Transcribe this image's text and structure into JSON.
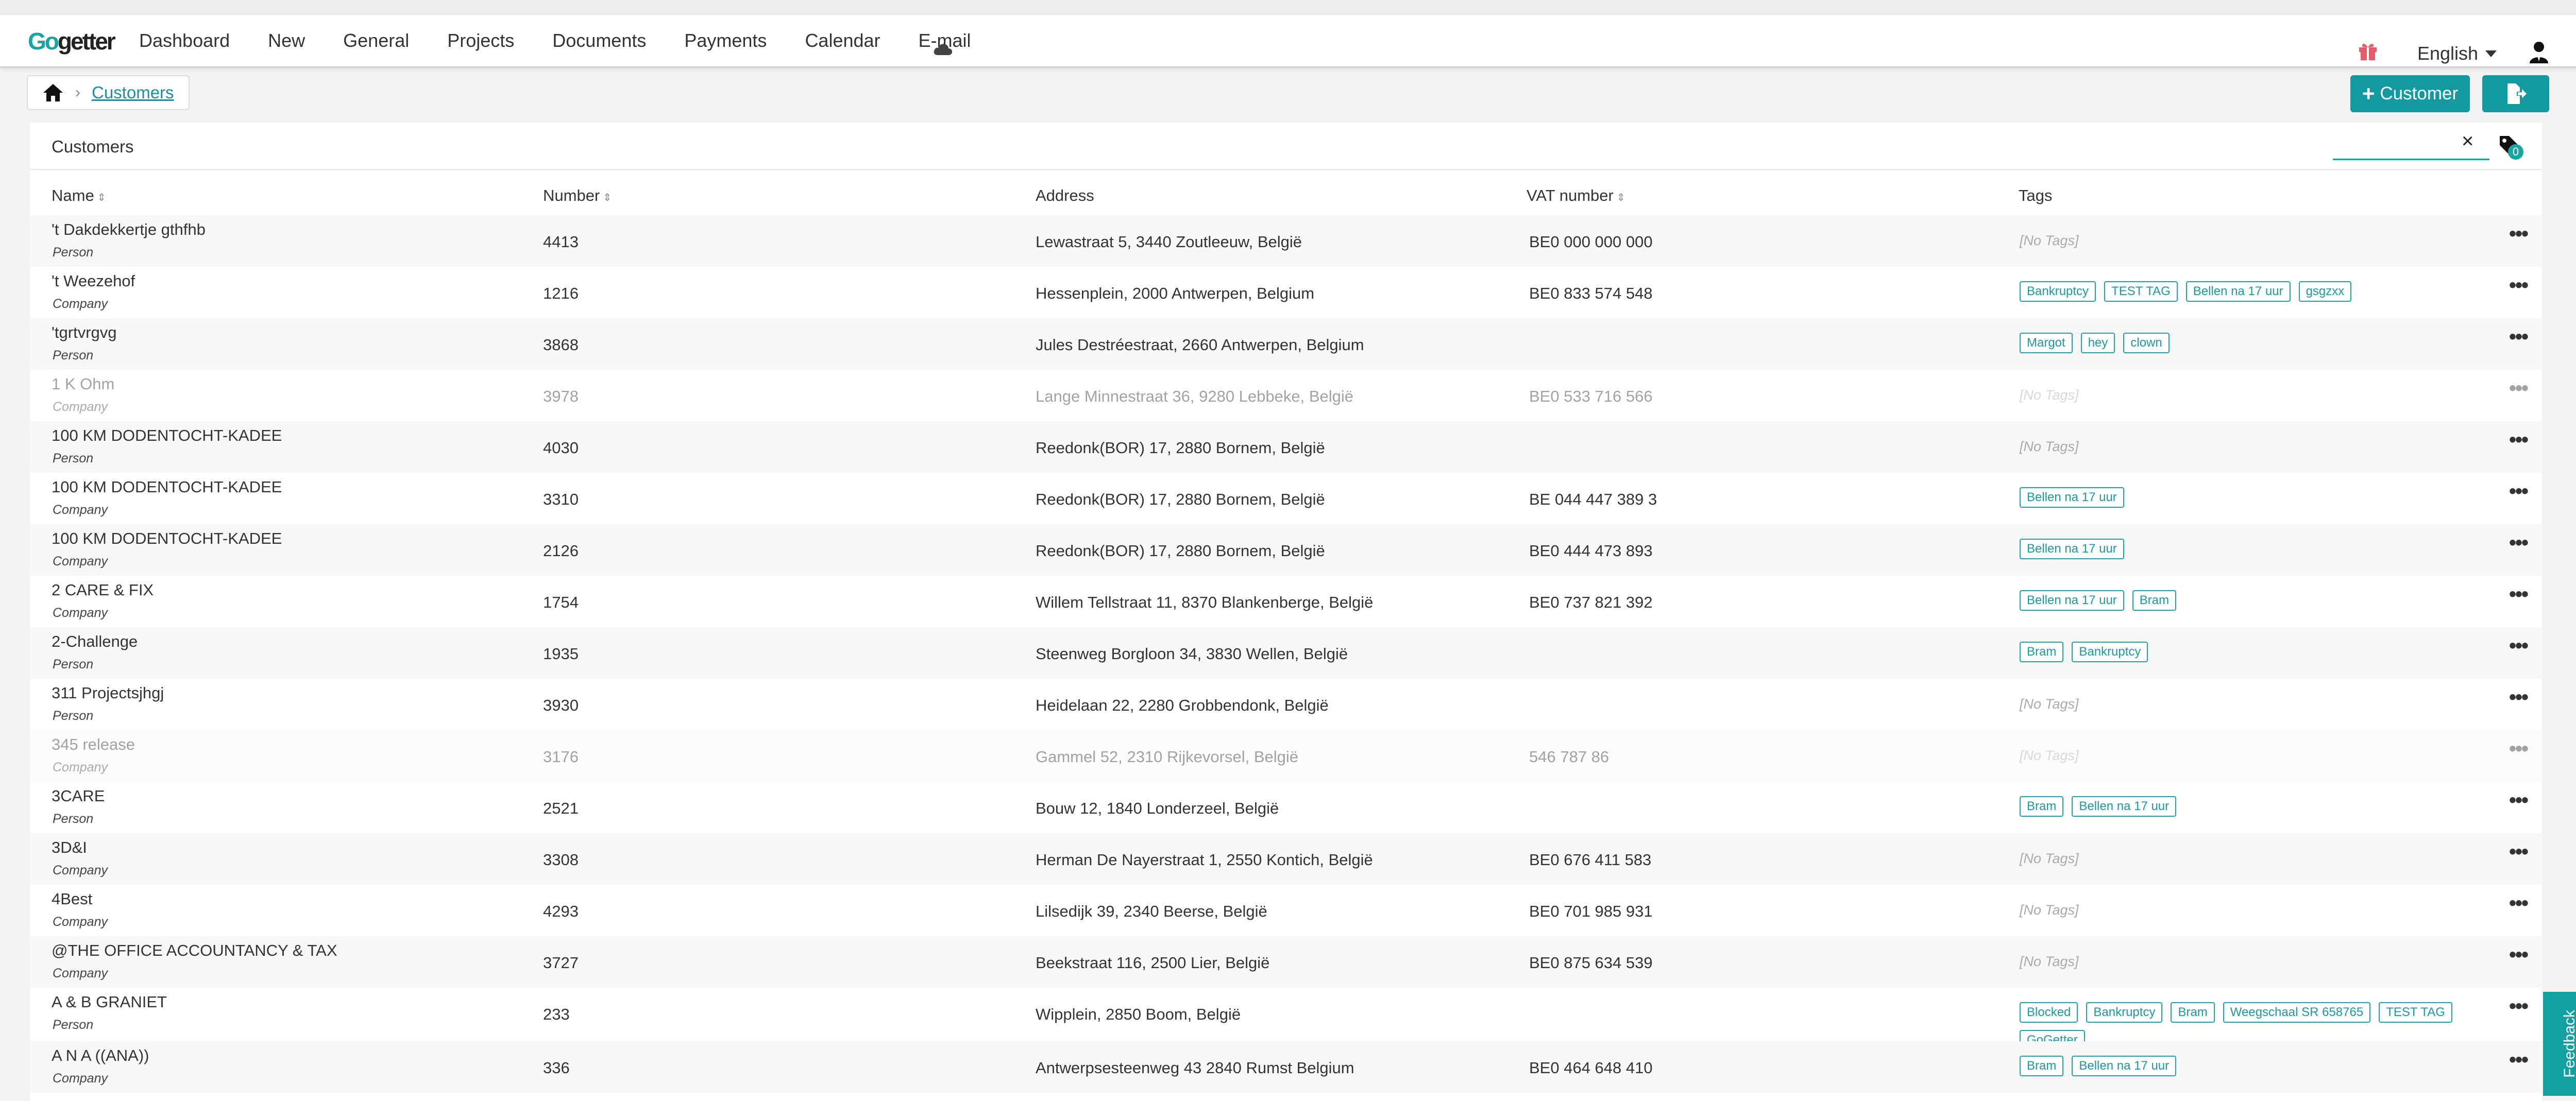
{
  "nav": {
    "logo_go": "Go",
    "logo_rest": "getter",
    "items": [
      "Dashboard",
      "New",
      "General",
      "Projects",
      "Documents",
      "Payments",
      "Calendar",
      "E-mail"
    ],
    "language": "English"
  },
  "breadcrumb": {
    "current": "Customers"
  },
  "actions": {
    "add_customer": "Customer"
  },
  "panel": {
    "title": "Customers",
    "search_value": "",
    "tag_filter_count": "0"
  },
  "table": {
    "headers": {
      "name": "Name",
      "number": "Number",
      "address": "Address",
      "vat": "VAT number",
      "tags": "Tags"
    },
    "no_tags": "[No Tags]",
    "rows": [
      {
        "name": "'t Dakdekkertje gthfhb",
        "type": "Person",
        "number": "4413",
        "address": "Lewastraat 5, 3440 Zoutleeuw, België",
        "vat": "BE0 000 000 000",
        "tags": [],
        "dimmed": false
      },
      {
        "name": "'t Weezehof",
        "type": "Company",
        "number": "1216",
        "address": "Hessenplein, 2000 Antwerpen, Belgium",
        "vat": "BE0 833 574 548",
        "tags": [
          "Bankruptcy",
          "TEST TAG",
          "Bellen na 17 uur",
          "gsgzxx"
        ],
        "dimmed": false
      },
      {
        "name": "'tgrtvrgvg",
        "type": "Person",
        "number": "3868",
        "address": "Jules Destréestraat, 2660 Antwerpen, Belgium",
        "vat": "",
        "tags": [
          "Margot",
          "hey",
          "clown"
        ],
        "dimmed": false
      },
      {
        "name": "1 K Ohm",
        "type": "Company",
        "number": "3978",
        "address": "Lange Minnestraat 36, 9280 Lebbeke, België",
        "vat": "BE0 533 716 566",
        "tags": [],
        "dimmed": true
      },
      {
        "name": "100 KM DODENTOCHT-KADEE",
        "type": "Person",
        "number": "4030",
        "address": "Reedonk(BOR) 17, 2880 Bornem, België",
        "vat": "",
        "tags": [],
        "dimmed": false
      },
      {
        "name": "100 KM DODENTOCHT-KADEE",
        "type": "Company",
        "number": "3310",
        "address": "Reedonk(BOR) 17, 2880 Bornem, België",
        "vat": "BE 044 447 389 3",
        "tags": [
          "Bellen na 17 uur"
        ],
        "dimmed": false
      },
      {
        "name": "100 KM DODENTOCHT-KADEE",
        "type": "Company",
        "number": "2126",
        "address": "Reedonk(BOR) 17, 2880 Bornem, België",
        "vat": "BE0 444 473 893",
        "tags": [
          "Bellen na 17 uur"
        ],
        "dimmed": false
      },
      {
        "name": "2 CARE & FIX",
        "type": "Company",
        "number": "1754",
        "address": "Willem Tellstraat 11, 8370 Blankenberge, België",
        "vat": "BE0 737 821 392",
        "tags": [
          "Bellen na 17 uur",
          "Bram"
        ],
        "dimmed": false
      },
      {
        "name": "2-Challenge",
        "type": "Person",
        "number": "1935",
        "address": "Steenweg Borgloon 34, 3830 Wellen, België",
        "vat": "",
        "tags": [
          "Bram",
          "Bankruptcy"
        ],
        "dimmed": false
      },
      {
        "name": "311 Projectsjhgj",
        "type": "Person",
        "number": "3930",
        "address": "Heidelaan 22, 2280 Grobbendonk, België",
        "vat": "",
        "tags": [],
        "dimmed": false
      },
      {
        "name": "345 release",
        "type": "Company",
        "number": "3176",
        "address": "Gammel 52, 2310 Rijkevorsel, België",
        "vat": "546 787 86",
        "tags": [],
        "dimmed": true
      },
      {
        "name": "3CARE",
        "type": "Person",
        "number": "2521",
        "address": "Bouw 12, 1840 Londerzeel, België",
        "vat": "",
        "tags": [
          "Bram",
          "Bellen na 17 uur"
        ],
        "dimmed": false
      },
      {
        "name": "3D&I",
        "type": "Company",
        "number": "3308",
        "address": "Herman De Nayerstraat 1, 2550 Kontich, België",
        "vat": "BE0 676 411 583",
        "tags": [],
        "dimmed": false
      },
      {
        "name": "4Best",
        "type": "Company",
        "number": "4293",
        "address": "Lilsedijk 39, 2340 Beerse, België",
        "vat": "BE0 701 985 931",
        "tags": [],
        "dimmed": false
      },
      {
        "name": "@THE OFFICE ACCOUNTANCY & TAX",
        "type": "Company",
        "number": "3727",
        "address": "Beekstraat 116, 2500 Lier, België",
        "vat": "BE0 875 634 539",
        "tags": [],
        "dimmed": false
      },
      {
        "name": "A & B GRANIET",
        "type": "Person",
        "number": "233",
        "address": "Wipplein, 2850 Boom, België",
        "vat": "",
        "tags": [
          "Blocked",
          "Bankruptcy",
          "Bram",
          "Weegschaal SR 658765",
          "TEST TAG",
          "GoGetter"
        ],
        "dimmed": false
      },
      {
        "name": "A N A ((ANA))",
        "type": "Company",
        "number": "336",
        "address": "Antwerpsesteenweg 43 2840 Rumst Belgium",
        "vat": "BE0 464 648 410",
        "tags": [
          "Bram",
          "Bellen na 17 uur"
        ],
        "dimmed": false
      }
    ]
  },
  "feedback": {
    "label": "Feedback"
  }
}
